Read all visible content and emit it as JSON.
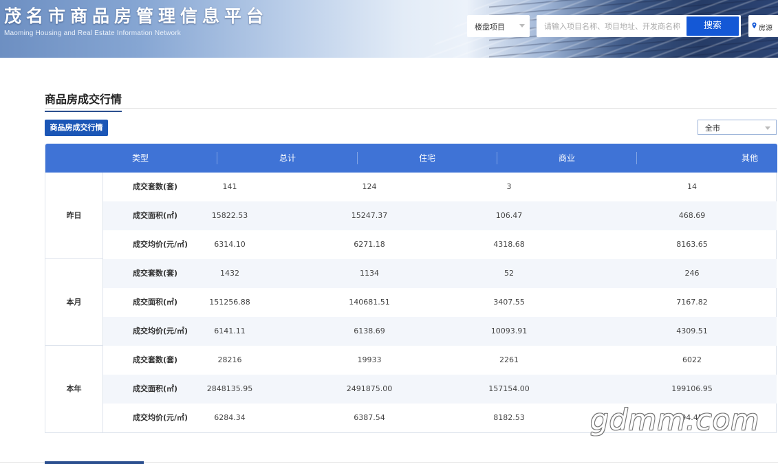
{
  "header": {
    "site_title": "茂名市商品房管理信息平台",
    "site_subtitle": "Maoming Housing and Real Estate Information Network",
    "search_type": "楼盘项目",
    "search_placeholder": "请输入项目名称、项目地址、开发商名称",
    "search_button": "搜索",
    "region_button": "房源"
  },
  "section": {
    "title": "商品房成交行情",
    "tab_label": "商品房成交行情",
    "city_select": "全市"
  },
  "table": {
    "headers": [
      "类型",
      "总计",
      "住宅",
      "商业",
      "其他"
    ],
    "groups": [
      {
        "label": "昨日",
        "rows": [
          {
            "metric": "成交套数(套)",
            "values": [
              "141",
              "124",
              "3",
              "14"
            ]
          },
          {
            "metric": "成交面积(㎡)",
            "values": [
              "15822.53",
              "15247.37",
              "106.47",
              "468.69"
            ]
          },
          {
            "metric": "成交均价(元/㎡)",
            "values": [
              "6314.10",
              "6271.18",
              "4318.68",
              "8163.65"
            ]
          }
        ]
      },
      {
        "label": "本月",
        "rows": [
          {
            "metric": "成交套数(套)",
            "values": [
              "1432",
              "1134",
              "52",
              "246"
            ]
          },
          {
            "metric": "成交面积(㎡)",
            "values": [
              "151256.88",
              "140681.51",
              "3407.55",
              "7167.82"
            ]
          },
          {
            "metric": "成交均价(元/㎡)",
            "values": [
              "6141.11",
              "6138.69",
              "10093.91",
              "4309.51"
            ]
          }
        ]
      },
      {
        "label": "本年",
        "rows": [
          {
            "metric": "成交套数(套)",
            "values": [
              "28216",
              "19933",
              "2261",
              "6022"
            ]
          },
          {
            "metric": "成交面积(㎡)",
            "values": [
              "2848135.95",
              "2491875.00",
              "157154.00",
              "199106.95"
            ]
          },
          {
            "metric": "成交均价(元/㎡)",
            "values": [
              "6284.34",
              "6387.54",
              "8182.53",
              "94.45"
            ]
          }
        ]
      }
    ]
  },
  "watermark": "gdmm.com",
  "colors": {
    "header_blue": "#3f73d6",
    "button_blue": "#1458d6",
    "tab_blue": "#1b56b6",
    "alt_row": "#f3f6fb"
  }
}
